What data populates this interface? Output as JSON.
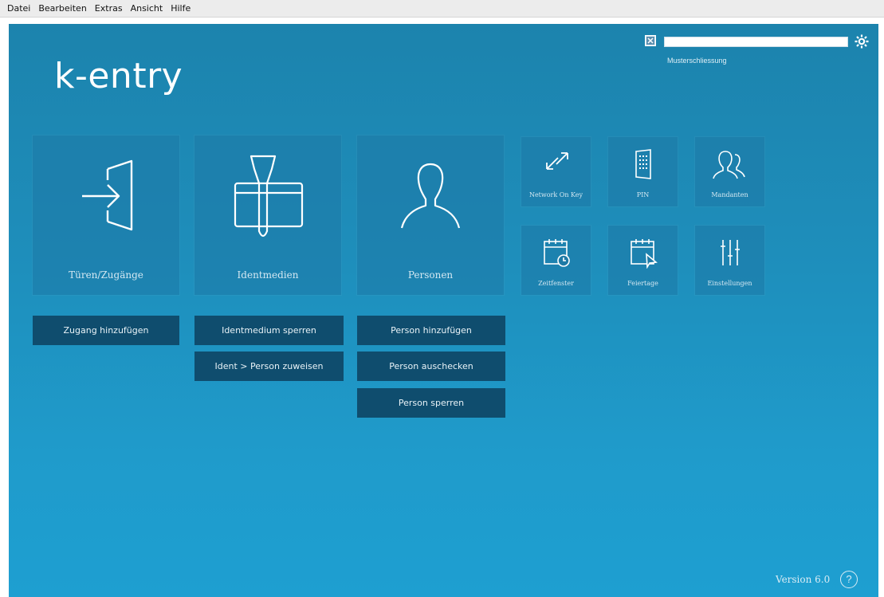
{
  "menubar": {
    "items": [
      "Datei",
      "Bearbeiten",
      "Extras",
      "Ansicht",
      "Hilfe"
    ]
  },
  "app": {
    "brand": "k-entry",
    "lock_label": "Musterschliessung",
    "version": "Version 6.0",
    "help_label": "?"
  },
  "tiles_large": [
    {
      "label": "Türen/Zugänge",
      "icon": "door-enter-icon"
    },
    {
      "label": "Identmedien",
      "icon": "keycard-icon"
    },
    {
      "label": "Personen",
      "icon": "person-icon"
    }
  ],
  "tiles_small": [
    {
      "label": "Network On Key",
      "icon": "network-arrows-icon"
    },
    {
      "label": "PIN",
      "icon": "keypad-icon"
    },
    {
      "label": "Mandanten",
      "icon": "clients-icon"
    },
    {
      "label": "Zeitfenster",
      "icon": "calendar-clock-icon"
    },
    {
      "label": "Feiertage",
      "icon": "calendar-flag-icon"
    },
    {
      "label": "Einstellungen",
      "icon": "sliders-icon"
    }
  ],
  "actions": {
    "zugang_hinzufuegen": "Zugang hinzufügen",
    "identmedium_sperren": "Identmedium sperren",
    "ident_person_zuweisen": "Ident > Person zuweisen",
    "person_hinzufuegen": "Person hinzufügen",
    "person_auschecken": "Person auschecken",
    "person_sperren": "Person sperren"
  },
  "colors": {
    "background_top": "#1c83ad",
    "background_bottom": "#1e9fd1",
    "button_bg": "#0f4d6e",
    "tile_bg": "#1e78a5"
  }
}
